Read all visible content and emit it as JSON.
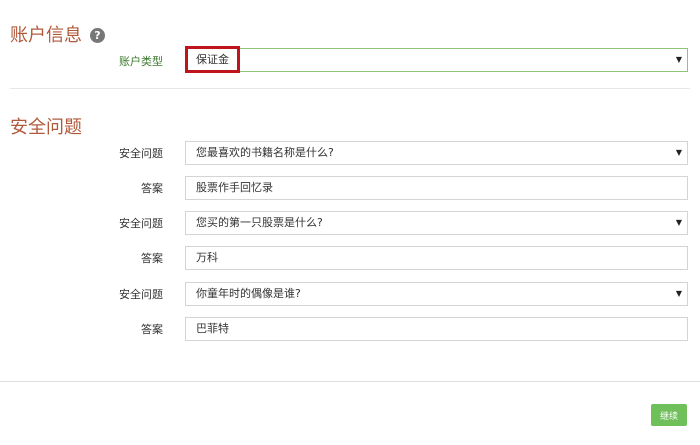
{
  "account_section": {
    "title": "账户信息",
    "help_icon_glyph": "?",
    "account_type_label": "账户类型",
    "account_type_value": "保证金"
  },
  "security_section": {
    "title": "安全问题",
    "items": [
      {
        "question_label": "安全问题",
        "question_value": "您最喜欢的书籍名称是什么?",
        "answer_label": "答案",
        "answer_value": "股票作手回忆录"
      },
      {
        "question_label": "安全问题",
        "question_value": "您买的第一只股票是什么?",
        "answer_label": "答案",
        "answer_value": "万科"
      },
      {
        "question_label": "安全问题",
        "question_value": "你童年时的偶像是谁?",
        "answer_label": "答案",
        "answer_value": "巴菲特"
      }
    ]
  },
  "footer": {
    "continue_label": "继续"
  },
  "icons": {
    "caret": "▼"
  },
  "colors": {
    "section_title": "#b05a3c",
    "highlight": "#c0141d",
    "button": "#6fbf5a",
    "label_active": "#3c7a2c"
  }
}
